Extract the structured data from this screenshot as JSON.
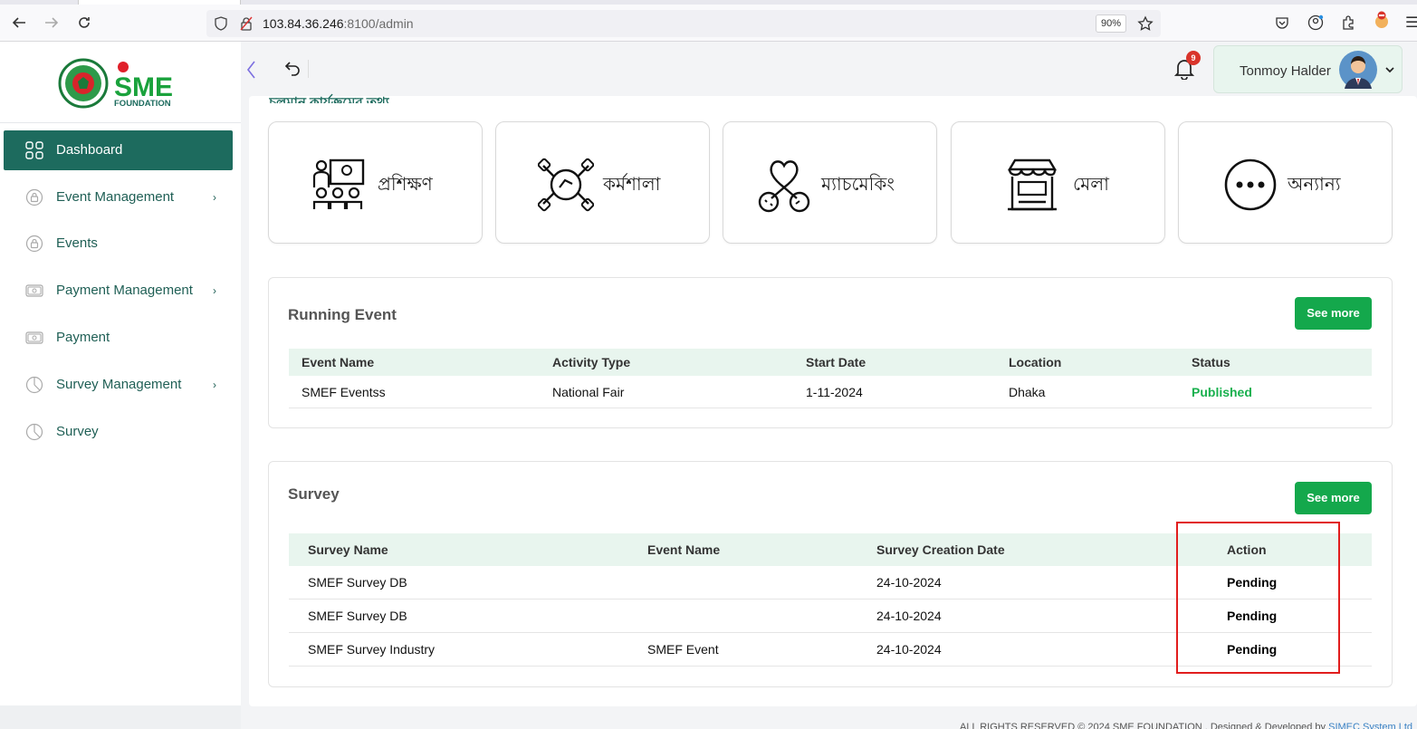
{
  "browser": {
    "url_host": "103.84.36.246",
    "url_rest": ":8100/admin",
    "zoom": "90%"
  },
  "sidebar": {
    "items": [
      {
        "label": "Dashboard",
        "icon": "grid-icon",
        "active": true,
        "has_submenu": false
      },
      {
        "label": "Event Management",
        "icon": "lock-circle-icon",
        "has_submenu": true
      },
      {
        "label": "Events",
        "icon": "lock-circle-icon",
        "has_submenu": false
      },
      {
        "label": "Payment Management",
        "icon": "money-icon",
        "has_submenu": true
      },
      {
        "label": "Payment",
        "icon": "money-icon",
        "has_submenu": false
      },
      {
        "label": "Survey Management",
        "icon": "pie-chart-icon",
        "has_submenu": true
      },
      {
        "label": "Survey",
        "icon": "pie-chart-icon",
        "has_submenu": false
      }
    ],
    "chevron": "›"
  },
  "header": {
    "notification_count": "9",
    "user_name": "Tonmoy Halder"
  },
  "main": {
    "section_heading": "চলমান কার্যক্রমের তথ্য",
    "categories": [
      {
        "label": "প্রশিক্ষণ",
        "icon": "training-icon"
      },
      {
        "label": "কর্মশালা",
        "icon": "workshop-icon"
      },
      {
        "label": "ম্যাচমেকিং",
        "icon": "matchmaking-icon"
      },
      {
        "label": "মেলা",
        "icon": "fair-stall-icon"
      },
      {
        "label": "অন্যান্য",
        "icon": "more-dots-icon"
      }
    ],
    "running_event": {
      "title": "Running Event",
      "see_more": "See more",
      "columns": [
        "Event Name",
        "Activity Type",
        "Start Date",
        "Location",
        "Status"
      ],
      "rows": [
        [
          "SMEF Eventss",
          "National Fair",
          "1-11-2024",
          "Dhaka",
          "Published"
        ]
      ]
    },
    "survey": {
      "title": "Survey",
      "see_more": "See more",
      "columns": [
        "Survey Name",
        "Event Name",
        "Survey Creation Date",
        "Action"
      ],
      "rows": [
        [
          "SMEF Survey DB",
          "",
          "24-10-2024",
          "Pending"
        ],
        [
          "SMEF Survey DB",
          "",
          "24-10-2024",
          "Pending"
        ],
        [
          "SMEF Survey Industry",
          "SMEF Event",
          "24-10-2024",
          "Pending"
        ]
      ]
    }
  },
  "footer": {
    "text": "ALL RIGHTS RESERVED © 2024 SME FOUNDATION . Designed & Developed by",
    "link": "SIMEC System Ltd"
  },
  "colors": {
    "primary": "#1d6b5e",
    "accent_green": "#14a84c",
    "table_head": "#e8f5ee",
    "highlight": "#e11d1d"
  }
}
